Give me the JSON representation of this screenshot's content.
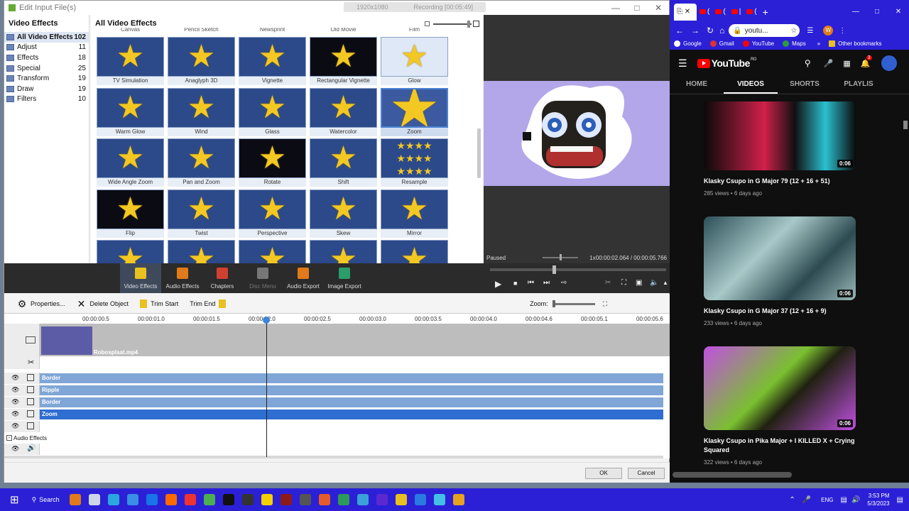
{
  "editor": {
    "window_title": "Edit Input File(s)",
    "recording_badge": {
      "resolution": "1920x1080",
      "status": "Recording [00:05:49]"
    },
    "categories_header": "Video Effects",
    "categories": [
      {
        "label": "All Video Effects",
        "count": "102",
        "selected": true
      },
      {
        "label": "Adjust",
        "count": "11"
      },
      {
        "label": "Effects",
        "count": "18"
      },
      {
        "label": "Special",
        "count": "25"
      },
      {
        "label": "Transform",
        "count": "19"
      },
      {
        "label": "Draw",
        "count": "19"
      },
      {
        "label": "Filters",
        "count": "10"
      }
    ],
    "effects_header": "All Video Effects",
    "partial_row": [
      "Canvas",
      "Pencil Sketch",
      "Newsprint",
      "Old Movie",
      "Film"
    ],
    "effects": [
      "TV Simulation",
      "Anaglyph 3D",
      "Vignette",
      "Rectangular Vignette",
      "Glow",
      "Warm Glow",
      "Wind",
      "Glass",
      "Watercolor",
      "Zoom",
      "Wide Angle Zoom",
      "Pan and Zoom",
      "Rotate",
      "Shift",
      "Resample",
      "Flip",
      "Twist",
      "Perspective",
      "Skew",
      "Mirror"
    ],
    "selected_effect": "Zoom",
    "preview": {
      "status": "Paused",
      "speed": "1x",
      "time_current": "00:00:02.064",
      "time_total": "00:00:05.766"
    },
    "tool_tabs": [
      "Video Effects",
      "Audio Effects",
      "Chapters",
      "Disc Menu",
      "Audio Export",
      "Image Export"
    ],
    "timeline_toolbar": {
      "properties": "Properties...",
      "delete": "Delete Object",
      "trim_start": "Trim Start",
      "trim_end": "Trim End",
      "zoom": "Zoom:"
    },
    "ruler_ticks": [
      "00:00:00.5",
      "00:00:01.0",
      "00:00:01.5",
      "00:00:02.0",
      "00:00:02.5",
      "00:00:03.0",
      "00:00:03.5",
      "00:00:04.0",
      "00:00:04.6",
      "00:00:05.1",
      "00:00:05.6"
    ],
    "clip_name": "Robosplaat.mp4",
    "effect_tracks": [
      "Border",
      "Ripple",
      "Border",
      "Zoom"
    ],
    "audio_effects_label": "Audio Effects",
    "ok_label": "OK",
    "cancel_label": "Cancel"
  },
  "browser": {
    "address": "youtu...",
    "bookmarks": [
      "Google",
      "Gmail",
      "YouTube",
      "Maps"
    ],
    "other_bookmarks": "Other bookmarks",
    "notifications": "3",
    "avatar_letter": "W",
    "logo_text": "YouTube",
    "region": "RO",
    "nav": [
      "HOME",
      "VIDEOS",
      "SHORTS",
      "PLAYLIS"
    ],
    "active_nav": "VIDEOS",
    "videos": [
      {
        "title": "Klasky Csupo in G Major 79 (12 + 16 + 51)",
        "meta": "285 views • 6 days ago",
        "duration": "0:06"
      },
      {
        "title": "Klasky Csupo in G Major 37 (12 + 16 + 9)",
        "meta": "233 views • 6 days ago",
        "duration": "0:06"
      },
      {
        "title": "Klasky Csupo in Pika Major + I KILLED X + Crying Squared",
        "meta": "322 views • 6 days ago",
        "duration": "0:06"
      }
    ]
  },
  "taskbar": {
    "search_label": "Search",
    "language": "ENG",
    "time": "3:53 PM",
    "date": "5/3/2023"
  }
}
